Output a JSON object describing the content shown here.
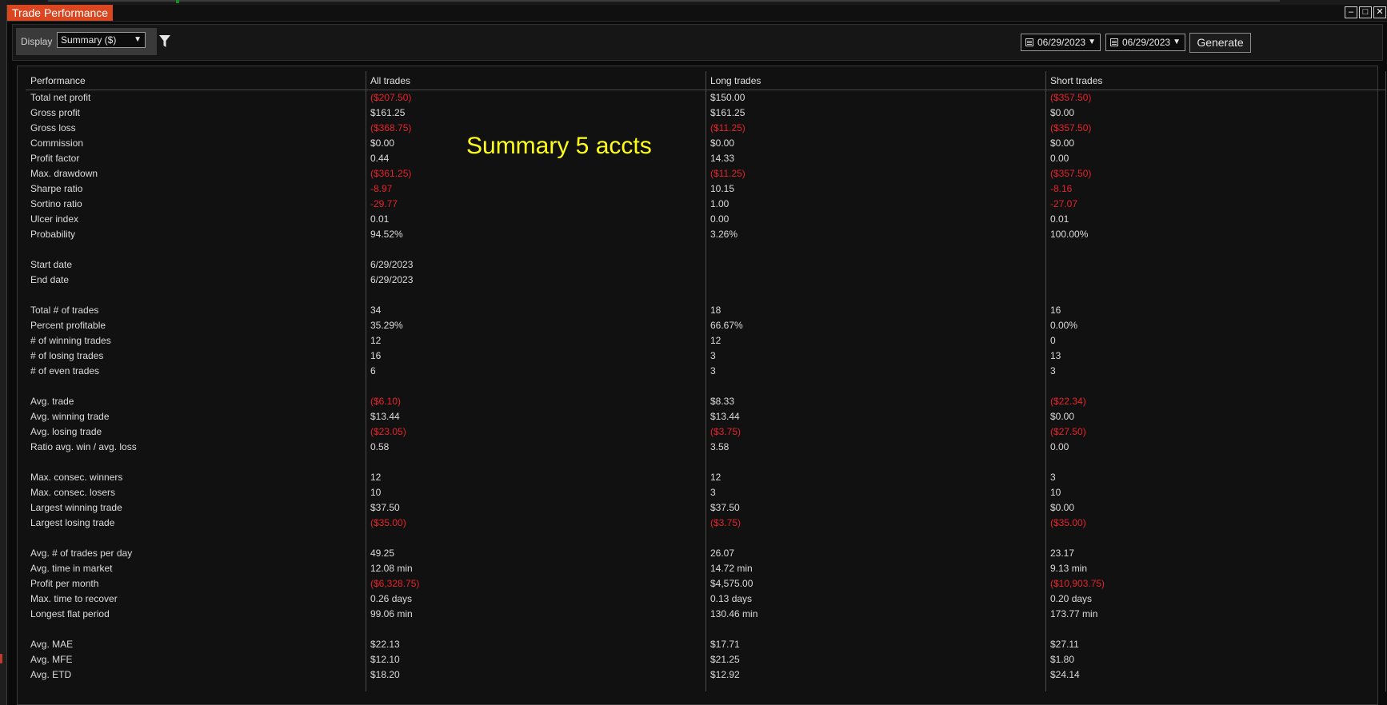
{
  "window": {
    "title": "Trade Performance",
    "controls": [
      "–",
      "□",
      "✕"
    ]
  },
  "toolbar": {
    "display_label": "Display",
    "display_value": "Summary ($)",
    "date_from": "06/29/2023",
    "date_to": "06/29/2023",
    "generate_label": "Generate"
  },
  "overlay_text": "Summary 5 accts",
  "colors": {
    "negative": "#e5232b",
    "tab": "#d9461f",
    "overlay": "#ffff18"
  },
  "table": {
    "headers": [
      "Performance",
      "All trades",
      "Long trades",
      "Short trades"
    ],
    "rows": [
      {
        "label": "Total net profit",
        "all": "($207.50)",
        "long": "$150.00",
        "short": "($357.50)"
      },
      {
        "label": "Gross profit",
        "all": "$161.25",
        "long": "$161.25",
        "short": "$0.00"
      },
      {
        "label": "Gross loss",
        "all": "($368.75)",
        "long": "($11.25)",
        "short": "($357.50)"
      },
      {
        "label": "Commission",
        "all": "$0.00",
        "long": "$0.00",
        "short": "$0.00"
      },
      {
        "label": "Profit factor",
        "all": "0.44",
        "long": "14.33",
        "short": "0.00"
      },
      {
        "label": "Max. drawdown",
        "all": "($361.25)",
        "long": "($11.25)",
        "short": "($357.50)"
      },
      {
        "label": "Sharpe ratio",
        "all": "-8.97",
        "long": "10.15",
        "short": "-8.16"
      },
      {
        "label": "Sortino ratio",
        "all": "-29.77",
        "long": "1.00",
        "short": "-27.07"
      },
      {
        "label": "Ulcer index",
        "all": "0.01",
        "long": "0.00",
        "short": "0.01"
      },
      {
        "label": "Probability",
        "all": "94.52%",
        "long": "3.26%",
        "short": "100.00%"
      },
      {
        "label": "",
        "all": "",
        "long": "",
        "short": ""
      },
      {
        "label": "Start date",
        "all": "6/29/2023",
        "long": "",
        "short": ""
      },
      {
        "label": "End date",
        "all": "6/29/2023",
        "long": "",
        "short": ""
      },
      {
        "label": "",
        "all": "",
        "long": "",
        "short": ""
      },
      {
        "label": "Total # of trades",
        "all": "34",
        "long": "18",
        "short": "16"
      },
      {
        "label": "Percent profitable",
        "all": "35.29%",
        "long": "66.67%",
        "short": "0.00%"
      },
      {
        "label": "# of winning trades",
        "all": "12",
        "long": "12",
        "short": "0"
      },
      {
        "label": "# of losing trades",
        "all": "16",
        "long": "3",
        "short": "13"
      },
      {
        "label": "# of even trades",
        "all": "6",
        "long": "3",
        "short": "3"
      },
      {
        "label": "",
        "all": "",
        "long": "",
        "short": ""
      },
      {
        "label": "Avg. trade",
        "all": "($6.10)",
        "long": "$8.33",
        "short": "($22.34)"
      },
      {
        "label": "Avg. winning trade",
        "all": "$13.44",
        "long": "$13.44",
        "short": "$0.00"
      },
      {
        "label": "Avg. losing trade",
        "all": "($23.05)",
        "long": "($3.75)",
        "short": "($27.50)"
      },
      {
        "label": "Ratio avg. win / avg. loss",
        "all": "0.58",
        "long": "3.58",
        "short": "0.00"
      },
      {
        "label": "",
        "all": "",
        "long": "",
        "short": ""
      },
      {
        "label": "Max. consec. winners",
        "all": "12",
        "long": "12",
        "short": "3"
      },
      {
        "label": "Max. consec. losers",
        "all": "10",
        "long": "3",
        "short": "10"
      },
      {
        "label": "Largest winning trade",
        "all": "$37.50",
        "long": "$37.50",
        "short": "$0.00"
      },
      {
        "label": "Largest losing trade",
        "all": "($35.00)",
        "long": "($3.75)",
        "short": "($35.00)"
      },
      {
        "label": "",
        "all": "",
        "long": "",
        "short": ""
      },
      {
        "label": "Avg. # of trades per day",
        "all": "49.25",
        "long": "26.07",
        "short": "23.17"
      },
      {
        "label": "Avg. time in market",
        "all": "12.08 min",
        "long": "14.72 min",
        "short": "9.13 min"
      },
      {
        "label": "Profit per month",
        "all": "($6,328.75)",
        "long": "$4,575.00",
        "short": "($10,903.75)"
      },
      {
        "label": "Max. time to recover",
        "all": "0.26 days",
        "long": "0.13 days",
        "short": "0.20 days"
      },
      {
        "label": "Longest flat period",
        "all": "99.06 min",
        "long": "130.46 min",
        "short": "173.77 min"
      },
      {
        "label": "",
        "all": "",
        "long": "",
        "short": ""
      },
      {
        "label": "Avg. MAE",
        "all": "$22.13",
        "long": "$17.71",
        "short": "$27.11"
      },
      {
        "label": "Avg. MFE",
        "all": "$12.10",
        "long": "$21.25",
        "short": "$1.80"
      },
      {
        "label": "Avg. ETD",
        "all": "$18.20",
        "long": "$12.92",
        "short": "$24.14"
      }
    ]
  }
}
